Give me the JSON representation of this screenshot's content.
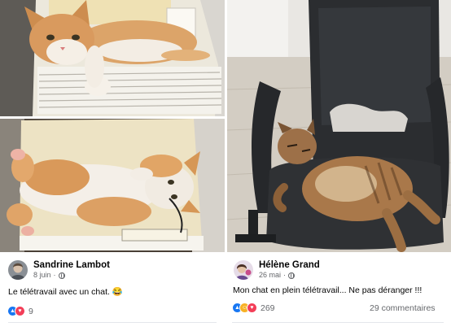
{
  "posts": [
    {
      "author": "Sandrine Lambot",
      "date": "8 juin",
      "privacy_icon": "globe-icon",
      "text": "Le télétravail avec un chat. 😂",
      "reaction_icons": [
        "like",
        "love"
      ],
      "reaction_count": "9"
    },
    {
      "author": "Hélène Grand",
      "date": "26 mai",
      "privacy_icon": "globe-icon",
      "text": "Mon chat en plein télétravail... Ne pas déranger !!!",
      "reaction_icons": [
        "like",
        "haha",
        "love"
      ],
      "reaction_count": "269",
      "comments": "29 commentaires"
    }
  ],
  "colors": {
    "like": "#1877f2",
    "love": "#f33e58",
    "haha": "#f7b125",
    "secondary_text": "#65676b"
  }
}
